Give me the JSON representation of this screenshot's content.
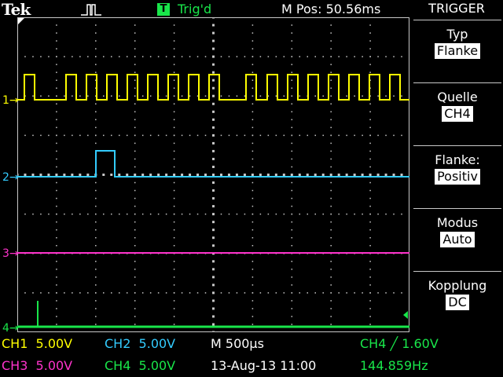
{
  "header": {
    "brand": "Tek",
    "trigger_icon": "pulse-icon",
    "trig_status_letter": "T",
    "trig_status": "Trig'd",
    "position": "M Pos: 50.56ms"
  },
  "colors": {
    "ch1": "#ffff00",
    "ch2": "#33ccff",
    "ch3": "#ff33cc",
    "ch4": "#19e64a",
    "grid": "#c8c8c8",
    "background": "#000000"
  },
  "channels": {
    "ch1_marker": "1",
    "ch2_marker": "2",
    "ch3_marker": "3",
    "ch4_marker": "4"
  },
  "menu": {
    "title": "TRIGGER",
    "items": [
      {
        "label": "Typ",
        "value": "Flanke"
      },
      {
        "label": "Quelle",
        "value": "CH4"
      },
      {
        "label": "Flanke:",
        "value": "Positiv"
      },
      {
        "label": "Modus",
        "value": "Auto"
      },
      {
        "label": "Kopplung",
        "value": "DC"
      }
    ]
  },
  "status": {
    "ch1": "CH1  5.00V",
    "ch2": "CH2  5.00V",
    "ch3": "CH3  5.00V",
    "ch4": "CH4  5.00V",
    "timebase": "M 500µs",
    "date": "13-Aug-13 11:00",
    "trigger": "CH4 ╱ 1.60V",
    "frequency": "144.859Hz"
  }
}
